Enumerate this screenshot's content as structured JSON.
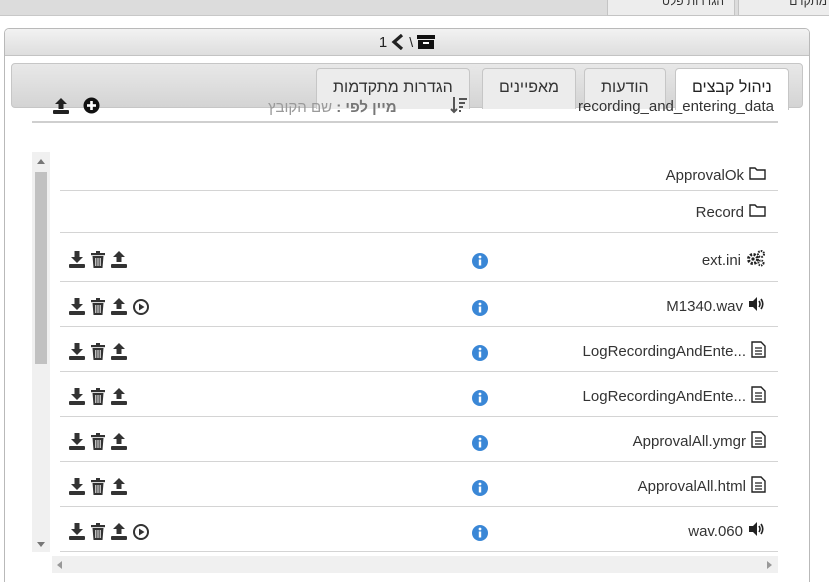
{
  "top_tabs": [
    {
      "label": "מתקדם"
    },
    {
      "label": "הגדרות פלט"
    }
  ],
  "dialog": {
    "page_number": "1",
    "path_separator": "\\"
  },
  "tabs": [
    {
      "label": "ניהול קבצים",
      "active": true
    },
    {
      "label": "הודעות",
      "active": false
    },
    {
      "label": "מאפיינים",
      "active": false
    },
    {
      "label": "הגדרות מתקדמות",
      "active": false
    }
  ],
  "toolbar": {
    "current_path": "recording_and_entering_data",
    "sort_prefix": "מיין לפי :",
    "sort_value": "שם הקובץ"
  },
  "files": [
    {
      "name": "ApprovalOk",
      "icon": "folder-icon",
      "type": "folder"
    },
    {
      "name": "Record",
      "icon": "folder-icon",
      "type": "folder"
    },
    {
      "name": "ext.ini",
      "icon": "gears-icon",
      "type": "file",
      "play": false
    },
    {
      "name": "M1340.wav",
      "icon": "speaker-icon",
      "type": "file",
      "play": true
    },
    {
      "name": "LogRecordingAndEnte...",
      "icon": "document-icon",
      "type": "file",
      "play": false
    },
    {
      "name": "LogRecordingAndEnte...",
      "icon": "document-icon",
      "type": "file",
      "play": false
    },
    {
      "name": "ApprovalAll.ymgr",
      "icon": "document-icon",
      "type": "file",
      "play": false
    },
    {
      "name": "ApprovalAll.html",
      "icon": "document-icon",
      "type": "file",
      "play": false
    },
    {
      "name": "wav.060",
      "icon": "speaker-icon",
      "type": "file",
      "play": true
    }
  ],
  "colors": {
    "info_blue": "#3a87d6",
    "icon_dark": "#333333"
  }
}
